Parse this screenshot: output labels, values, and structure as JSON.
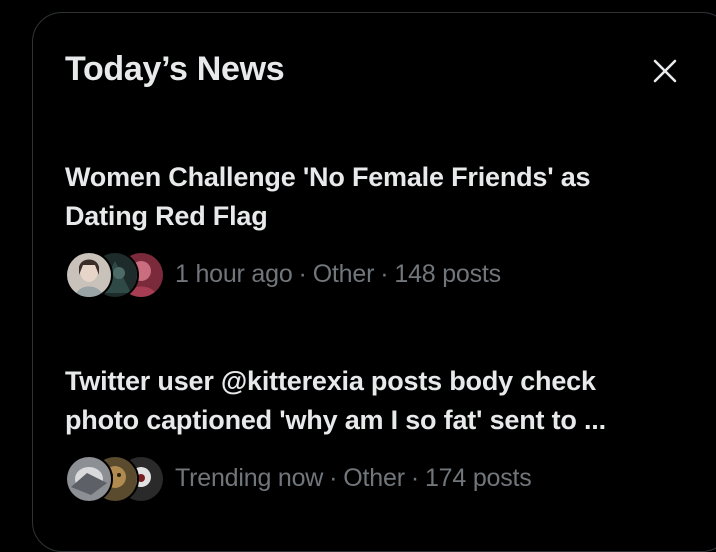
{
  "header": {
    "title": "Today’s News"
  },
  "icons": {
    "close": "close-icon"
  },
  "colors": {
    "background": "#000000",
    "text_primary": "#e7e9ea",
    "text_secondary": "#71767b",
    "border": "#2f3336"
  },
  "stories": [
    {
      "headline_line1": "Women Challenge 'No Female Friends' as",
      "headline_line2": "Dating Red Flag",
      "time": "1 hour ago",
      "category": "Other",
      "posts": "148 posts",
      "separator": "·"
    },
    {
      "headline_line1": "Twitter user @kitterexia posts body check",
      "headline_line2": "photo captioned 'why am I so fat' sent to ...",
      "time": "Trending now",
      "category": "Other",
      "posts": "174 posts",
      "separator": "·"
    }
  ]
}
